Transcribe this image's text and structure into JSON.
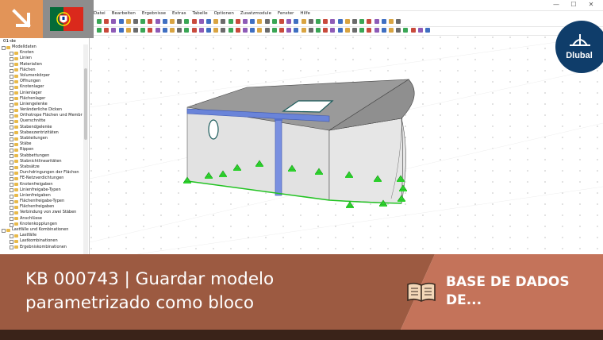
{
  "window": {
    "minimize": "—",
    "maximize": "☐",
    "close": "✕"
  },
  "menu": [
    "Datei",
    "Bearbeiten",
    "Ergebnisse",
    "Extras",
    "Tabelle",
    "Optionen",
    "Zusatzmodule",
    "Fenster",
    "Hilfe"
  ],
  "navigator": {
    "header": "Navigator - Daten",
    "root": "01-de",
    "items": [
      {
        "label": "Modelldaten",
        "level": 1
      },
      {
        "label": "Knoten",
        "level": 2
      },
      {
        "label": "Linien",
        "level": 2
      },
      {
        "label": "Materialien",
        "level": 2
      },
      {
        "label": "Flächen",
        "level": 2
      },
      {
        "label": "Volumenkörper",
        "level": 2
      },
      {
        "label": "Öffnungen",
        "level": 2
      },
      {
        "label": "Knotenlager",
        "level": 2
      },
      {
        "label": "Linienlager",
        "level": 2
      },
      {
        "label": "Flächenlager",
        "level": 2
      },
      {
        "label": "Liniengelenke",
        "level": 2
      },
      {
        "label": "Veränderliche Dicken",
        "level": 2
      },
      {
        "label": "Orthotrope Flächen und Membr",
        "level": 2
      },
      {
        "label": "Querschnitte",
        "level": 2
      },
      {
        "label": "Stabendgelenke",
        "level": 2
      },
      {
        "label": "Stabexzentrizitäten",
        "level": 2
      },
      {
        "label": "Stabteilungen",
        "level": 2
      },
      {
        "label": "Stäbe",
        "level": 2
      },
      {
        "label": "Rippen",
        "level": 2
      },
      {
        "label": "Stabbettungen",
        "level": 2
      },
      {
        "label": "Stabnichtlinearitäten",
        "level": 2
      },
      {
        "label": "Stabsätze",
        "level": 2
      },
      {
        "label": "Durchdringungen der Flächen",
        "level": 2
      },
      {
        "label": "FE-Netzverdichtungen",
        "level": 2
      },
      {
        "label": "Knotenfreigaben",
        "level": 2
      },
      {
        "label": "Linienfreigabe-Typen",
        "level": 2
      },
      {
        "label": "Linienfreigaben",
        "level": 2
      },
      {
        "label": "Flächenfreigabe-Typen",
        "level": 2
      },
      {
        "label": "Flächenfreigaben",
        "level": 2
      },
      {
        "label": "Verbindung von zwei Stäben",
        "level": 2
      },
      {
        "label": "Anschlüsse",
        "level": 2
      },
      {
        "label": "Knotenkopplungen",
        "level": 2
      },
      {
        "label": "Lastfälle und Kombinationen",
        "level": 1
      },
      {
        "label": "Lastfälle",
        "level": 2
      },
      {
        "label": "Lastkombinationen",
        "level": 2
      },
      {
        "label": "Ergebniskombinationen",
        "level": 2
      }
    ]
  },
  "brand": {
    "name": "Dlubal",
    "accent": "#c4735a",
    "banner_left": "#9c5a41",
    "banner_right": "#c4735a",
    "logo_color": "#0f3d6a"
  },
  "banner": {
    "title_line1": "KB 000743 | Guardar modelo",
    "title_line2": "parametrizado como bloco",
    "section_line1": "BASE DE DADOS",
    "section_line2": "DE..."
  },
  "icons": {
    "corner": "arrow-down-right-icon",
    "flag": "portugal-flag-icon",
    "book": "open-book-icon"
  }
}
